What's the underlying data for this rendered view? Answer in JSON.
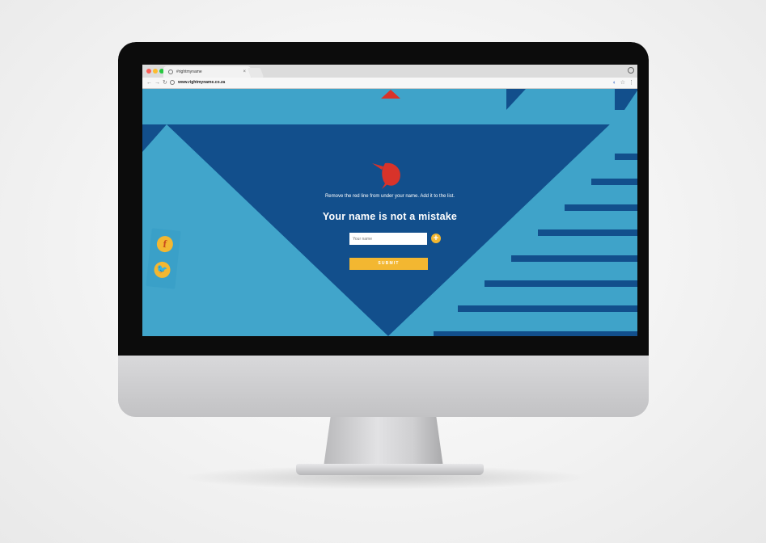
{
  "browser": {
    "tab_title": "#rightmyname",
    "tab_close": "×",
    "url": "www.rightmyname.co.za",
    "nav": {
      "back": "←",
      "forward": "→",
      "reload": "↻"
    },
    "toolbar_icons": [
      "translate-icon",
      "bookmark-star-icon",
      "menu-icon"
    ],
    "toolbar_glyphs": {
      "translate": "◐",
      "star": "☆",
      "menu": "⋮"
    }
  },
  "page": {
    "instruction": "Remove the red line from under your name. Add it to the list.",
    "headline": "Your name is not a mistake",
    "name_input": {
      "placeholder": "Your name",
      "value": ""
    },
    "add_button": "+",
    "submit_button": "SUBMIT",
    "social": {
      "facebook": "f",
      "twitter": "🐦"
    }
  },
  "colors": {
    "background_blue": "#3fa3c9",
    "dark_blue": "#124f8c",
    "accent_yellow": "#f3b731",
    "accent_red": "#d8332a"
  }
}
